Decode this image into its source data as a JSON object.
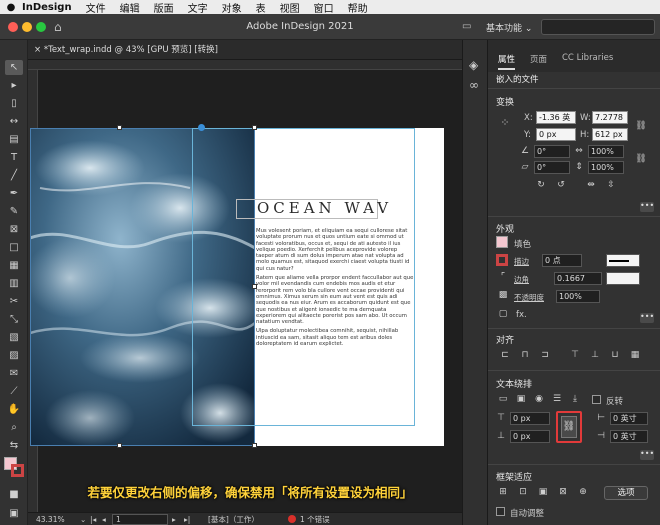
{
  "menubar": {
    "app_name": "InDesign",
    "items": [
      "文件",
      "编辑",
      "版面",
      "文字",
      "对象",
      "表",
      "视图",
      "窗口",
      "帮助"
    ]
  },
  "titlebar": {
    "title": "Adobe InDesign 2021",
    "workspace": "基本功能",
    "workspace_chevron": "⌄"
  },
  "document": {
    "tab_label": "*Text_wrap.indd @ 43% [GPU 预览] [转换]",
    "close_glyph": "×"
  },
  "layout": {
    "heading": "OCEAN WAV",
    "paragraphs": [
      "Mus volesent poriam, et eliquiam ea sequi cullorese sitat voluptate prorum nus et quos untium eate si ommod ut facesti voloratibus, occus et, sequi de ati autesto il ius velique poedio. Xerferchit pelibus aceprovide volorep taeper atum di sum dolus imperum atae nat volupta ad molo quamus est, sitaquod exerchi ciaest volupta tiusti id qui cus natur?",
      "Ratem que aliame vella prorpor endent faccullabor aut que volor mil evendandis cum endebis mos audis et etur rerorporit rem volo bla cullore vent occae providenti qui omnimus. Ximus serum sin eum aut vent est quis adi sequodis ea nus eiur. Arum es accaborum quidunt est que que nostibus et aligent ionsedic te ma demquata experiorem qui alitaecte porerist pos sam abo. Ut occum natatium vendtat.",
      "Ulpa doluptatur molectibea comnihit, sequist, nihillab intiuscid ea sam, sitasit aliquo tem est aribus doles doloreptatem id earum explictet."
    ]
  },
  "caption": "若要仅更改右侧的偏移，确保禁用「将所有设置设为相同」",
  "status": {
    "zoom": "43.31%",
    "page": "1",
    "style": "[基本]（工作）",
    "errors": "1 个错误",
    "error_color": "#d9302a"
  },
  "panel": {
    "tabs": [
      "属性",
      "页面",
      "CC Libraries"
    ],
    "object_type": "嵌入的文件",
    "transform": {
      "title": "变换",
      "x_label": "X:",
      "x_value": "-1.36 英",
      "y_label": "Y:",
      "y_value": "0 px",
      "w_label": "W:",
      "w_value": "7.2778",
      "h_label": "H:",
      "h_value": "612 px",
      "angle_value": "0°",
      "shear_value": "0°",
      "scale_x_value": "100%",
      "scale_y_value": "100%"
    },
    "appearance": {
      "title": "外观",
      "fill_label": "填色",
      "fill_color": "#f4c7d0",
      "stroke_label": "描边",
      "stroke_value": "0 点",
      "corner_label": "边角",
      "corner_value": "0.1667",
      "opacity_label": "不透明度",
      "opacity_value": "100%",
      "fx_label": "fx."
    },
    "align": {
      "title": "对齐"
    },
    "text_wrap": {
      "title": "文本绕排",
      "invert_label": "反转",
      "top_offset": "0 px",
      "bottom_offset": "0 px",
      "left_offset": "0 英寸",
      "right_offset": "0 英寸"
    },
    "frame_fitting": {
      "title": "框架适应",
      "options_button": "选项",
      "auto_fit_label": "自动调整"
    },
    "more_glyph": "•••"
  },
  "colors": {
    "highlight": "#e23a3a",
    "caption": "#ffd23a",
    "frame_guide": "#6ab4d8"
  }
}
